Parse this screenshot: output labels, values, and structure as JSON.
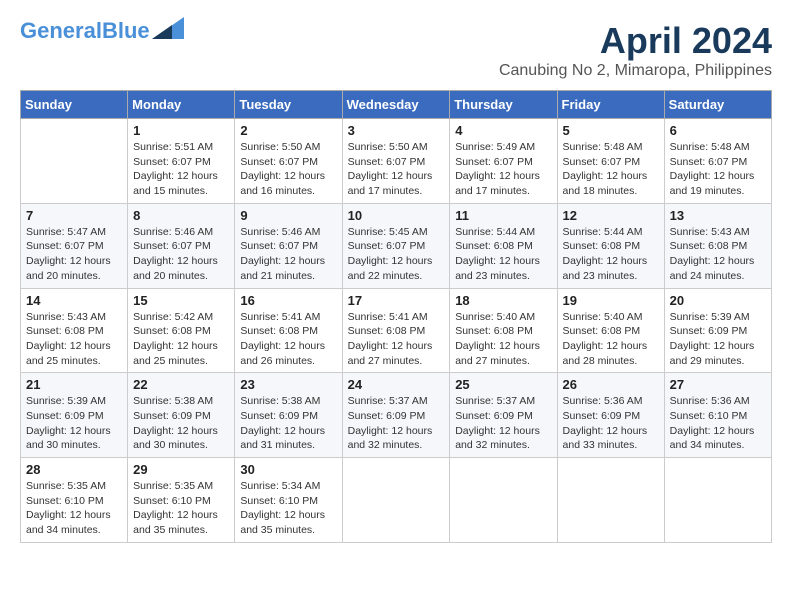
{
  "header": {
    "logo_line1": "General",
    "logo_line2": "Blue",
    "title": "April 2024",
    "subtitle": "Canubing No 2, Mimaropa, Philippines"
  },
  "weekdays": [
    "Sunday",
    "Monday",
    "Tuesday",
    "Wednesday",
    "Thursday",
    "Friday",
    "Saturday"
  ],
  "weeks": [
    [
      {
        "day": "",
        "info": ""
      },
      {
        "day": "1",
        "info": "Sunrise: 5:51 AM\nSunset: 6:07 PM\nDaylight: 12 hours\nand 15 minutes."
      },
      {
        "day": "2",
        "info": "Sunrise: 5:50 AM\nSunset: 6:07 PM\nDaylight: 12 hours\nand 16 minutes."
      },
      {
        "day": "3",
        "info": "Sunrise: 5:50 AM\nSunset: 6:07 PM\nDaylight: 12 hours\nand 17 minutes."
      },
      {
        "day": "4",
        "info": "Sunrise: 5:49 AM\nSunset: 6:07 PM\nDaylight: 12 hours\nand 17 minutes."
      },
      {
        "day": "5",
        "info": "Sunrise: 5:48 AM\nSunset: 6:07 PM\nDaylight: 12 hours\nand 18 minutes."
      },
      {
        "day": "6",
        "info": "Sunrise: 5:48 AM\nSunset: 6:07 PM\nDaylight: 12 hours\nand 19 minutes."
      }
    ],
    [
      {
        "day": "7",
        "info": "Sunrise: 5:47 AM\nSunset: 6:07 PM\nDaylight: 12 hours\nand 20 minutes."
      },
      {
        "day": "8",
        "info": "Sunrise: 5:46 AM\nSunset: 6:07 PM\nDaylight: 12 hours\nand 20 minutes."
      },
      {
        "day": "9",
        "info": "Sunrise: 5:46 AM\nSunset: 6:07 PM\nDaylight: 12 hours\nand 21 minutes."
      },
      {
        "day": "10",
        "info": "Sunrise: 5:45 AM\nSunset: 6:07 PM\nDaylight: 12 hours\nand 22 minutes."
      },
      {
        "day": "11",
        "info": "Sunrise: 5:44 AM\nSunset: 6:08 PM\nDaylight: 12 hours\nand 23 minutes."
      },
      {
        "day": "12",
        "info": "Sunrise: 5:44 AM\nSunset: 6:08 PM\nDaylight: 12 hours\nand 23 minutes."
      },
      {
        "day": "13",
        "info": "Sunrise: 5:43 AM\nSunset: 6:08 PM\nDaylight: 12 hours\nand 24 minutes."
      }
    ],
    [
      {
        "day": "14",
        "info": "Sunrise: 5:43 AM\nSunset: 6:08 PM\nDaylight: 12 hours\nand 25 minutes."
      },
      {
        "day": "15",
        "info": "Sunrise: 5:42 AM\nSunset: 6:08 PM\nDaylight: 12 hours\nand 25 minutes."
      },
      {
        "day": "16",
        "info": "Sunrise: 5:41 AM\nSunset: 6:08 PM\nDaylight: 12 hours\nand 26 minutes."
      },
      {
        "day": "17",
        "info": "Sunrise: 5:41 AM\nSunset: 6:08 PM\nDaylight: 12 hours\nand 27 minutes."
      },
      {
        "day": "18",
        "info": "Sunrise: 5:40 AM\nSunset: 6:08 PM\nDaylight: 12 hours\nand 27 minutes."
      },
      {
        "day": "19",
        "info": "Sunrise: 5:40 AM\nSunset: 6:08 PM\nDaylight: 12 hours\nand 28 minutes."
      },
      {
        "day": "20",
        "info": "Sunrise: 5:39 AM\nSunset: 6:09 PM\nDaylight: 12 hours\nand 29 minutes."
      }
    ],
    [
      {
        "day": "21",
        "info": "Sunrise: 5:39 AM\nSunset: 6:09 PM\nDaylight: 12 hours\nand 30 minutes."
      },
      {
        "day": "22",
        "info": "Sunrise: 5:38 AM\nSunset: 6:09 PM\nDaylight: 12 hours\nand 30 minutes."
      },
      {
        "day": "23",
        "info": "Sunrise: 5:38 AM\nSunset: 6:09 PM\nDaylight: 12 hours\nand 31 minutes."
      },
      {
        "day": "24",
        "info": "Sunrise: 5:37 AM\nSunset: 6:09 PM\nDaylight: 12 hours\nand 32 minutes."
      },
      {
        "day": "25",
        "info": "Sunrise: 5:37 AM\nSunset: 6:09 PM\nDaylight: 12 hours\nand 32 minutes."
      },
      {
        "day": "26",
        "info": "Sunrise: 5:36 AM\nSunset: 6:09 PM\nDaylight: 12 hours\nand 33 minutes."
      },
      {
        "day": "27",
        "info": "Sunrise: 5:36 AM\nSunset: 6:10 PM\nDaylight: 12 hours\nand 34 minutes."
      }
    ],
    [
      {
        "day": "28",
        "info": "Sunrise: 5:35 AM\nSunset: 6:10 PM\nDaylight: 12 hours\nand 34 minutes."
      },
      {
        "day": "29",
        "info": "Sunrise: 5:35 AM\nSunset: 6:10 PM\nDaylight: 12 hours\nand 35 minutes."
      },
      {
        "day": "30",
        "info": "Sunrise: 5:34 AM\nSunset: 6:10 PM\nDaylight: 12 hours\nand 35 minutes."
      },
      {
        "day": "",
        "info": ""
      },
      {
        "day": "",
        "info": ""
      },
      {
        "day": "",
        "info": ""
      },
      {
        "day": "",
        "info": ""
      }
    ]
  ]
}
